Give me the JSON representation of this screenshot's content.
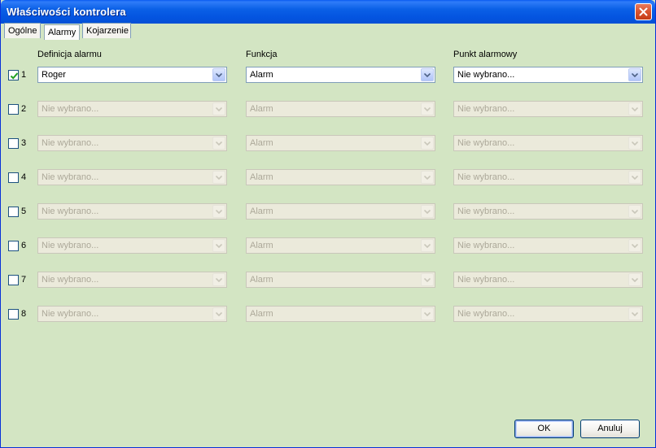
{
  "window": {
    "title": "Właściwości kontrolera"
  },
  "tabs": [
    {
      "label": "Ogólne",
      "active": false
    },
    {
      "label": "Alarmy",
      "active": true
    },
    {
      "label": "Kojarzenie",
      "active": false
    }
  ],
  "headers": {
    "definition": "Definicja alarmu",
    "function": "Funkcja",
    "point": "Punkt alarmowy"
  },
  "rows": [
    {
      "num": "1",
      "checked": true,
      "definition": "Roger",
      "function": "Alarm",
      "point": "Nie wybrano..."
    },
    {
      "num": "2",
      "checked": false,
      "definition": "Nie wybrano...",
      "function": "Alarm",
      "point": "Nie wybrano..."
    },
    {
      "num": "3",
      "checked": false,
      "definition": "Nie wybrano...",
      "function": "Alarm",
      "point": "Nie wybrano..."
    },
    {
      "num": "4",
      "checked": false,
      "definition": "Nie wybrano...",
      "function": "Alarm",
      "point": "Nie wybrano..."
    },
    {
      "num": "5",
      "checked": false,
      "definition": "Nie wybrano...",
      "function": "Alarm",
      "point": "Nie wybrano..."
    },
    {
      "num": "6",
      "checked": false,
      "definition": "Nie wybrano...",
      "function": "Alarm",
      "point": "Nie wybrano..."
    },
    {
      "num": "7",
      "checked": false,
      "definition": "Nie wybrano...",
      "function": "Alarm",
      "point": "Nie wybrano..."
    },
    {
      "num": "8",
      "checked": false,
      "definition": "Nie wybrano...",
      "function": "Alarm",
      "point": "Nie wybrano..."
    }
  ],
  "buttons": {
    "ok": "OK",
    "cancel": "Anuluj"
  },
  "icons": {
    "close": "close-icon",
    "dropdown": "chevron-down-icon",
    "check": "check-icon"
  },
  "colors": {
    "titlebar": "#0a5fe6",
    "client_background": "#d3e5c3",
    "checkmark": "#21a121"
  }
}
